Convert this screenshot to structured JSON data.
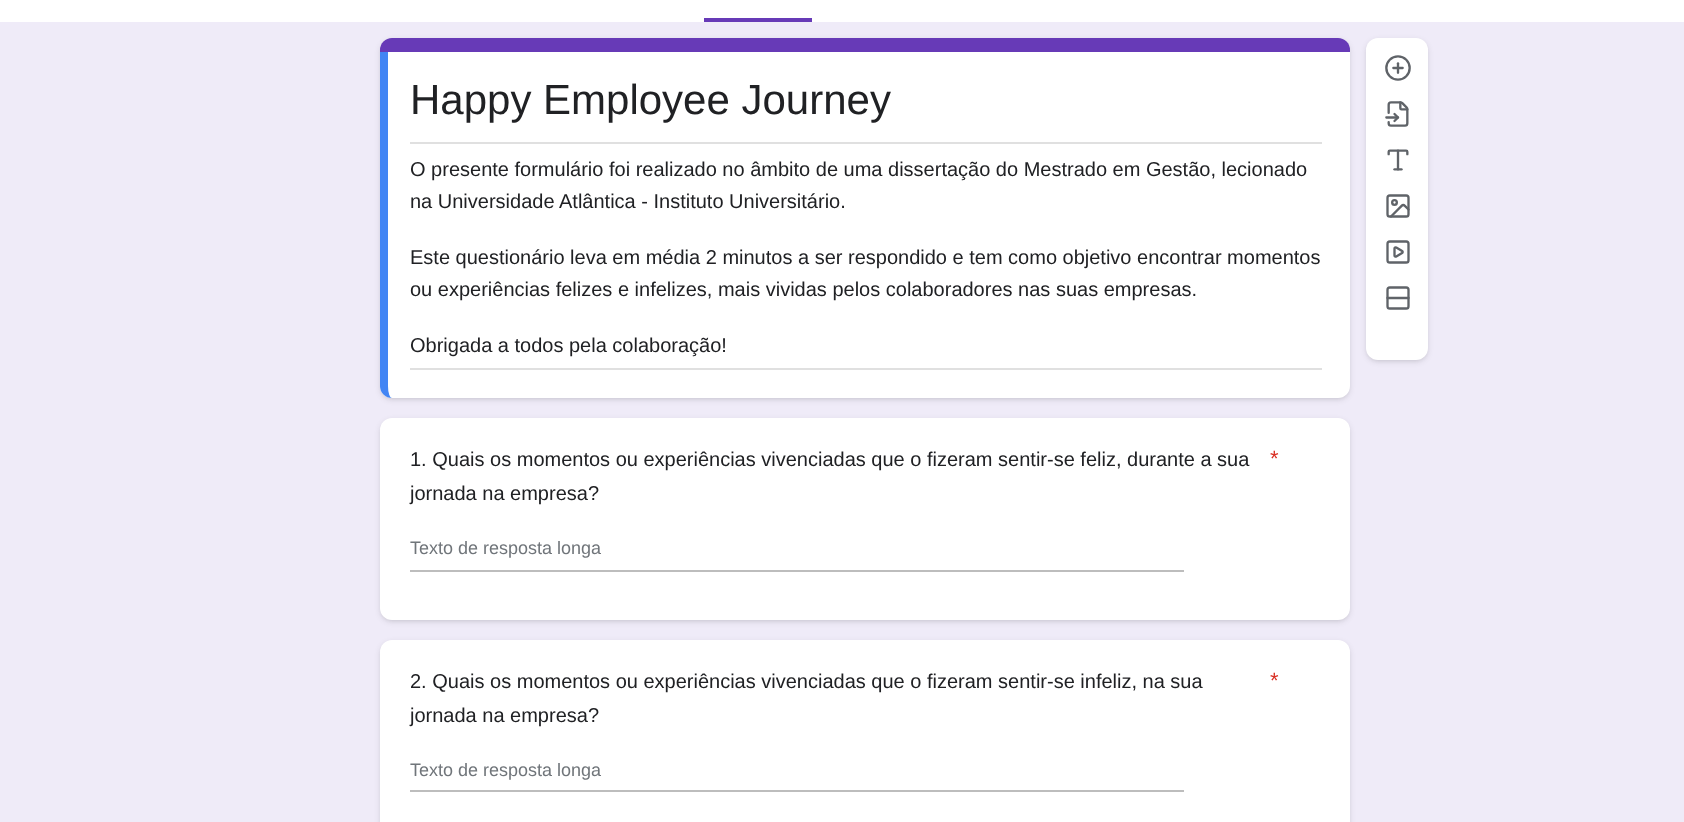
{
  "form": {
    "title": "Happy Employee Journey",
    "description": [
      "O presente formulário foi realizado no âmbito de uma dissertação do Mestrado em Gestão, lecionado na Universidade Atlântica - Instituto Universitário.",
      "Este questionário leva em média 2 minutos a ser respondido e tem como objetivo encontrar momentos ou experiências felizes e infelizes, mais vividas pelos colaboradores nas suas empresas.",
      "Obrigada a todos pela colaboração!"
    ]
  },
  "questions": [
    {
      "text": "1. Quais os momentos ou experiências vivenciadas que o fizeram sentir-se feliz, durante a sua jornada na empresa?",
      "required": true,
      "required_mark": "*",
      "placeholder": "Texto de resposta longa"
    },
    {
      "text": "2. Quais os momentos ou experiências vivenciadas  que o fizeram sentir-se infeliz, na sua jornada na empresa?",
      "required": true,
      "required_mark": "*",
      "placeholder": "Texto de resposta longa"
    }
  ]
}
